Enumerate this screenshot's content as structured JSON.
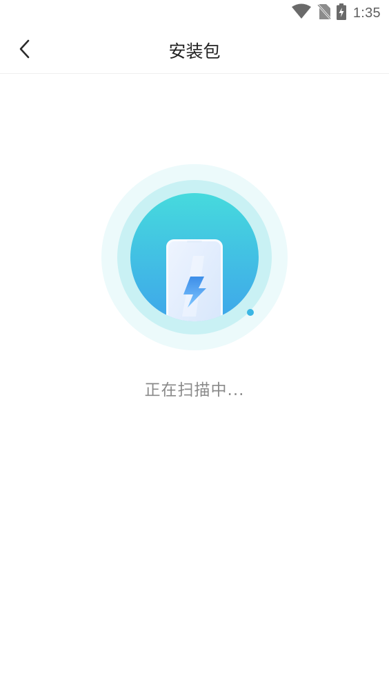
{
  "status_bar": {
    "time": "1:35",
    "icons": [
      "wifi-icon",
      "no-sim-icon",
      "battery-charging-icon"
    ]
  },
  "header": {
    "back_icon": "chevron-left-icon",
    "title": "安装包"
  },
  "scan": {
    "illustration": "phone-lightning-icon",
    "status_text": "正在扫描中..."
  },
  "colors": {
    "outer_ring": "#ecfafb",
    "inner_ring": "#c9f1f4",
    "gradient_top": "#44d8dd",
    "gradient_bottom": "#3fa8ea",
    "progress_dot": "#3bb6e4",
    "title_text": "#222222",
    "status_text": "#8a8a8a"
  }
}
